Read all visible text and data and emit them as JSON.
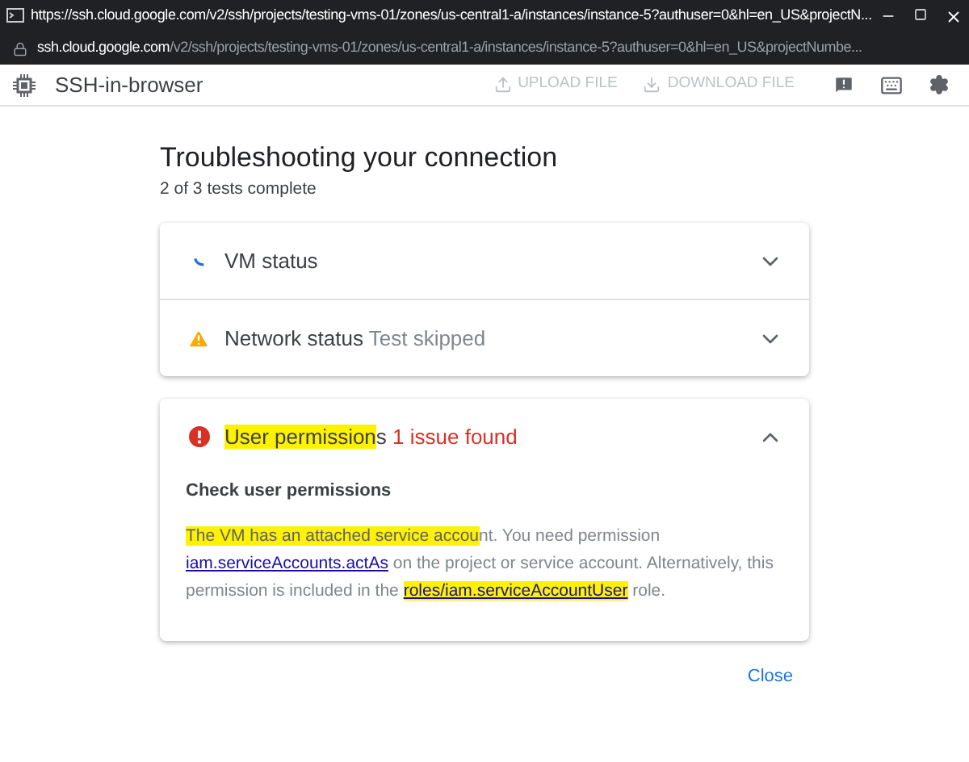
{
  "window": {
    "title": "https://ssh.cloud.google.com/v2/ssh/projects/testing-vms-01/zones/us-central1-a/instances/instance-5?authuser=0&hl=en_US&projectN..."
  },
  "address_bar": {
    "host": "ssh.cloud.google.com",
    "path": "/v2/ssh/projects/testing-vms-01/zones/us-central1-a/instances/instance-5?authuser=0&hl=en_US&projectNumbe..."
  },
  "app_bar": {
    "title": "SSH-in-browser",
    "actions": [
      {
        "label": "UPLOAD FILE",
        "disabled": true
      },
      {
        "label": "DOWNLOAD FILE",
        "disabled": true
      }
    ]
  },
  "heading": "Troubleshooting your connection",
  "progress": "2 of 3 tests complete",
  "tests": [
    {
      "kind": "running",
      "segments": [
        {
          "text": "VM status",
          "highlighted": false
        }
      ],
      "expanded": false
    },
    {
      "kind": "warning",
      "segments": [
        {
          "text": "Network status",
          "highlighted": false
        }
      ],
      "note": "Test skipped",
      "expanded": false
    }
  ],
  "issue": {
    "kind": "error",
    "segments": [
      {
        "text": "User permission",
        "highlighted": true
      },
      {
        "text": "s",
        "highlighted": false
      }
    ],
    "note": "1 issue found",
    "expanded": true,
    "detail_title": "Check user permissions",
    "paragraph": [
      {
        "kind": "text",
        "text": "The VM has an attached service accou",
        "highlighted": true
      },
      {
        "kind": "text",
        "text": "nt. You need permission ",
        "highlighted": false
      },
      {
        "kind": "link",
        "text": "iam.serviceAccounts.actAs",
        "highlighted": false
      },
      {
        "kind": "text",
        "text": " on the project or service account. Alternatively, this permission is included in the ",
        "highlighted": false
      },
      {
        "kind": "link",
        "text": "roles/iam.serviceAccountUser",
        "highlighted": true
      },
      {
        "kind": "text",
        "text": " role.",
        "highlighted": false
      }
    ]
  },
  "close": "Close"
}
